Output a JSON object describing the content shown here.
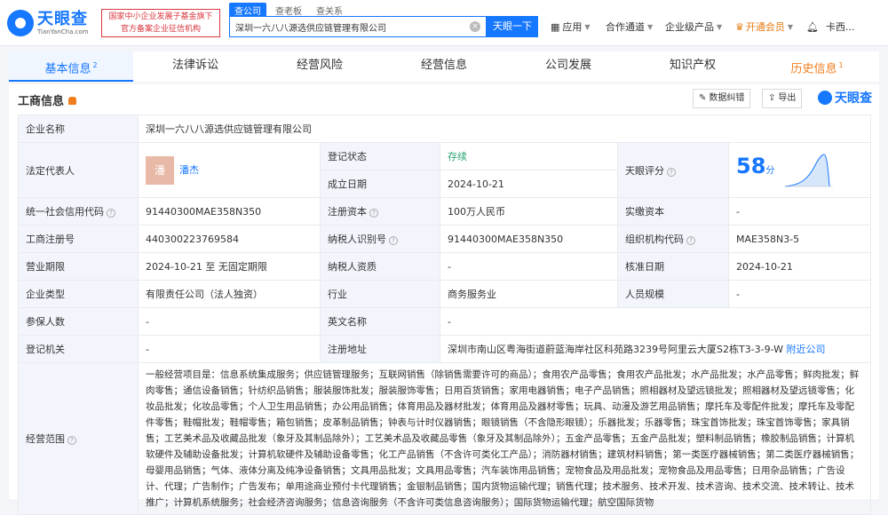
{
  "header": {
    "logo_cn": "天眼查",
    "logo_en": "TianYanCha.com",
    "gov_badge": "国家中小企业发展子基金旗下 官方备案企业征信机构",
    "search_tabs": [
      "查公司",
      "查老板",
      "查关系"
    ],
    "search_value": "深圳一六八八源选供应链管理有限公司",
    "search_button": "天眼一下",
    "nav": [
      "应用",
      "合作通道",
      "企业级产品",
      "开通会员",
      "卡西..."
    ]
  },
  "tabs": [
    {
      "label": "基本信息",
      "count": "2"
    },
    {
      "label": "法律诉讼"
    },
    {
      "label": "经营风险"
    },
    {
      "label": "经营信息"
    },
    {
      "label": "公司发展"
    },
    {
      "label": "知识产权"
    },
    {
      "label": "历史信息",
      "count": "1"
    }
  ],
  "panel": {
    "title": "工商信息",
    "btn_correct": "数据纠错",
    "btn_export": "导出",
    "brand": "天眼查"
  },
  "info": {
    "company_name_label": "企业名称",
    "company_name": "深圳一六八八源选供应链管理有限公司",
    "legal_rep_label": "法定代表人",
    "legal_rep_avatar": "潘",
    "legal_rep": "潘杰",
    "reg_status_label": "登记状态",
    "reg_status": "存续",
    "found_date_label": "成立日期",
    "found_date": "2024-10-21",
    "score_label": "天眼评分",
    "score": "58",
    "score_unit": "分",
    "credit_code_label": "统一社会信用代码",
    "credit_code": "91440300MAE358N350",
    "reg_capital_label": "注册资本",
    "reg_capital": "100万人民币",
    "paid_capital_label": "实缴资本",
    "paid_capital": "-",
    "reg_no_label": "工商注册号",
    "reg_no": "440300223769584",
    "taxpayer_id_label": "纳税人识别号",
    "taxpayer_id": "91440300MAE358N350",
    "org_code_label": "组织机构代码",
    "org_code": "MAE358N3-5",
    "term_label": "营业期限",
    "term": "2024-10-21 至 无固定期限",
    "taxpayer_qual_label": "纳税人资质",
    "taxpayer_qual": "-",
    "approve_date_label": "核准日期",
    "approve_date": "2024-10-21",
    "type_label": "企业类型",
    "type": "有限责任公司（法人独资）",
    "industry_label": "行业",
    "industry": "商务服务业",
    "staff_label": "人员规模",
    "staff": "-",
    "insured_label": "参保人数",
    "insured": "-",
    "en_name_label": "英文名称",
    "en_name": "-",
    "authority_label": "登记机关",
    "authority": "-",
    "address_label": "注册地址",
    "address": "深圳市南山区粤海街道蔚蓝海岸社区科苑路3239号阿里云大厦S2栋T3-3-9-W",
    "nearby": "附近公司",
    "scope_label": "经营范围",
    "scope": "一般经营项目是：信息系统集成服务；供应链管理服务；互联网销售（除销售需要许可的商品）；食用农产品零售；食用农产品批发；水产品批发；水产品零售；鲜肉批发；鲜肉零售；通信设备销售；针纺织品销售；服装服饰批发；服装服饰零售；日用百货销售；家用电器销售；电子产品销售；照相器材及望远镜批发；照相器材及望远镜零售；化妆品批发；化妆品零售；个人卫生用品销售；办公用品销售；体育用品及器材批发；体育用品及器材零售；玩具、动漫及游艺用品销售；摩托车及零配件批发；摩托车及零配件零售；鞋帽批发；鞋帽零售；箱包销售；皮革制品销售；钟表与计时仪器销售；眼镜销售（不含隐形眼镜）；乐器批发；乐器零售；珠宝首饰批发；珠宝首饰零售；家具销售；工艺美术品及收藏品批发（象牙及其制品除外）；工艺美术品及收藏品零售（象牙及其制品除外）；五金产品零售；五金产品批发；塑料制品销售；橡胶制品销售；计算机软硬件及辅助设备批发；计算机软硬件及辅助设备零售；化工产品销售（不含许可类化工产品）；消防器材销售；建筑材料销售；第一类医疗器械销售；第二类医疗器械销售；母婴用品销售；气体、液体分离及纯净设备销售；文具用品批发；文具用品零售；汽车装饰用品销售；宠物食品及用品批发；宠物食品及用品零售；日用杂品销售；广告设计、代理；广告制作；广告发布；单用途商业预付卡代理销售；金银制品销售；国内货物运输代理；销售代理；技术服务、技术开发、技术咨询、技术交流、技术转让、技术推广；计算机系统服务；社会经济咨询服务；信息咨询服务（不含许可类信息咨询服务）；国际货物运输代理；航空国际货物"
  }
}
